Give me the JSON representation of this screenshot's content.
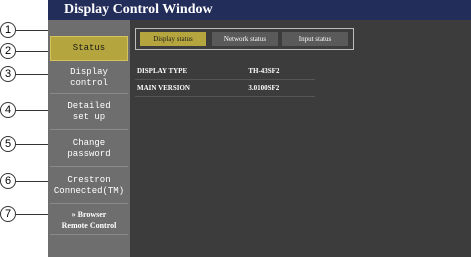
{
  "window": {
    "title": "Display Control Window"
  },
  "sidebar": {
    "items": [
      {
        "label": "Status"
      },
      {
        "label": "Display\ncontrol"
      },
      {
        "label": "Detailed\nset up"
      },
      {
        "label": "Change\npassword"
      },
      {
        "label": "Crestron\nConnected(TM)"
      },
      {
        "label": "» Browser\nRemote Control"
      }
    ]
  },
  "tabs": [
    {
      "label": "Display status"
    },
    {
      "label": "Network status"
    },
    {
      "label": "Input status"
    }
  ],
  "status_table": {
    "rows": [
      {
        "key": "DISPLAY TYPE",
        "value": "TH-43SF2"
      },
      {
        "key": "MAIN VERSION",
        "value": "3.0100SF2"
      }
    ]
  },
  "callouts": [
    "1",
    "2",
    "3",
    "4",
    "5",
    "6",
    "7"
  ],
  "colors": {
    "title_bar": "#232d5a",
    "active": "#b5a53e",
    "panel": "#3c3c3c",
    "sidebar": "#6e6e6e"
  }
}
